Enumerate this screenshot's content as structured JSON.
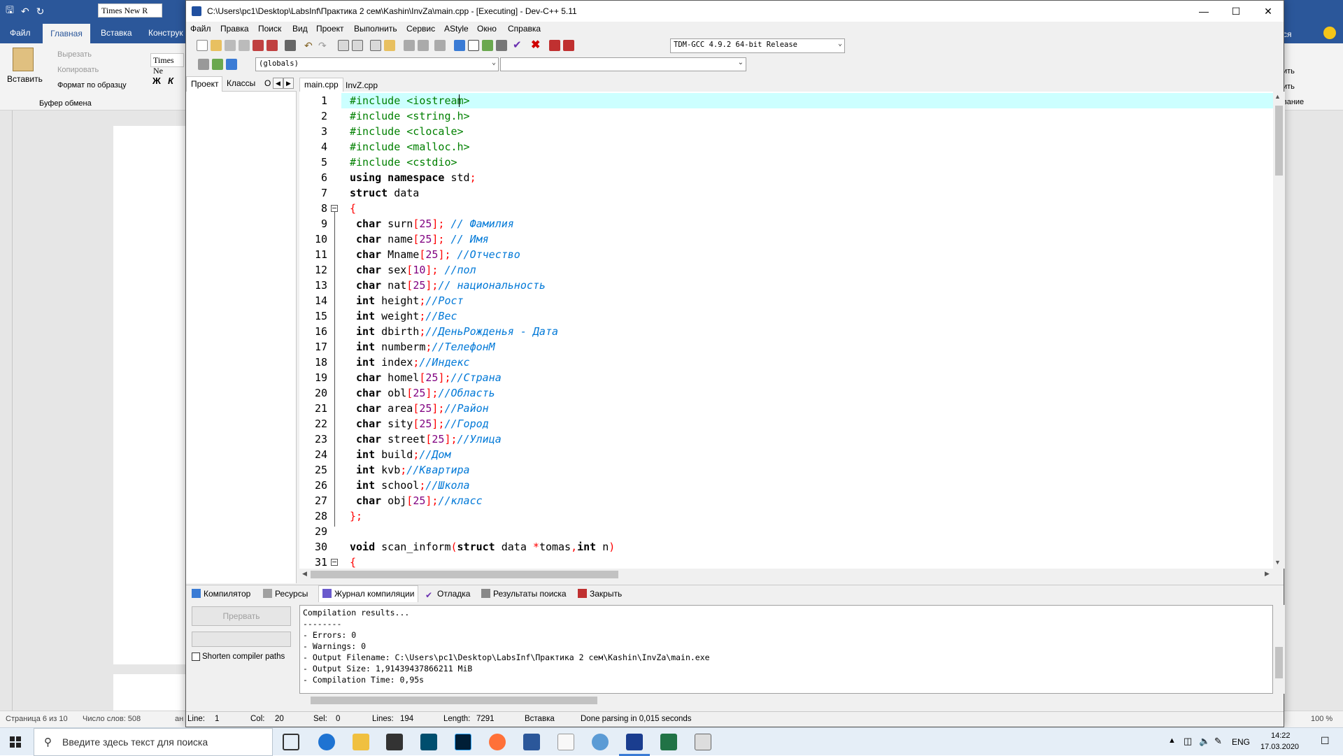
{
  "word": {
    "font_name": "Times New R",
    "font_name2": "Times Ne",
    "tabs": [
      "Файл",
      "Главная",
      "Вставка",
      "Конструк"
    ],
    "paste_label": "Вставить",
    "cut_label": "Вырезать",
    "copy_label": "Копировать",
    "format_painter_label": "Формат по образцу",
    "clipboard_group": "Буфер обмена",
    "bold": "Ж",
    "italic": "К",
    "right_ribbon_1": "ся",
    "right_ribbon_2": "ить",
    "right_ribbon_3": "ить",
    "right_ribbon_4": "вание",
    "status_page": "Страница 6 из 10",
    "status_words": "Число слов: 508",
    "status_lang": "ан",
    "zoom": "100 %"
  },
  "dev": {
    "title": "C:\\Users\\pc1\\Desktop\\LabsInf\\Практика 2 сем\\Kashin\\InvZa\\main.cpp - [Executing] - Dev-C++ 5.11",
    "menu": [
      "Файл",
      "Правка",
      "Поиск",
      "Вид",
      "Проект",
      "Выполнить",
      "Сервис",
      "AStyle",
      "Окно",
      "Справка"
    ],
    "compiler_select": "TDM-GCC 4.9.2 64-bit Release",
    "scope_select": "(globals)",
    "left_tabs": [
      "Проект",
      "Классы",
      "О"
    ],
    "editor_tabs": [
      "main.cpp",
      "InvZ.cpp"
    ],
    "line_numbers": [
      "1",
      "2",
      "3",
      "4",
      "5",
      "6",
      "7",
      "8",
      "9",
      "10",
      "11",
      "12",
      "13",
      "14",
      "15",
      "16",
      "17",
      "18",
      "19",
      "20",
      "21",
      "22",
      "23",
      "24",
      "25",
      "26",
      "27",
      "28",
      "29",
      "30",
      "31"
    ],
    "bottom_tabs": [
      "Компилятор",
      "Ресурсы",
      "Журнал компиляции",
      "Отладка",
      "Результаты поиска",
      "Закрыть"
    ],
    "abort_button": "Прервать",
    "shorten_paths": "Shorten compiler paths",
    "compile_log": [
      "Compilation results...",
      "--------",
      "- Errors: 0",
      "- Warnings: 0",
      "- Output Filename: C:\\Users\\pc1\\Desktop\\LabsInf\\Практика 2 сем\\Kashin\\InvZa\\main.exe",
      "- Output Size: 1,91439437866211 MiB",
      "- Compilation Time: 0,95s"
    ],
    "status": {
      "line_label": "Line:",
      "line_value": "1",
      "col_label": "Col:",
      "col_value": "20",
      "sel_label": "Sel:",
      "sel_value": "0",
      "lines_label": "Lines:",
      "lines_value": "194",
      "length_label": "Length:",
      "length_value": "7291",
      "mode": "Вставка",
      "message": "Done parsing in 0,015 seconds"
    }
  },
  "taskbar": {
    "search_placeholder": "Введите здесь текст для поиска",
    "lang": "ENG",
    "time": "14:22",
    "date": "17.03.2020"
  },
  "colors": {
    "word_blue": "#2b579a",
    "line_highlight": "#ccffff",
    "comment": "#0078d7",
    "preprocessor": "#008000",
    "symbol": "#ff0000",
    "number": "#800080"
  }
}
